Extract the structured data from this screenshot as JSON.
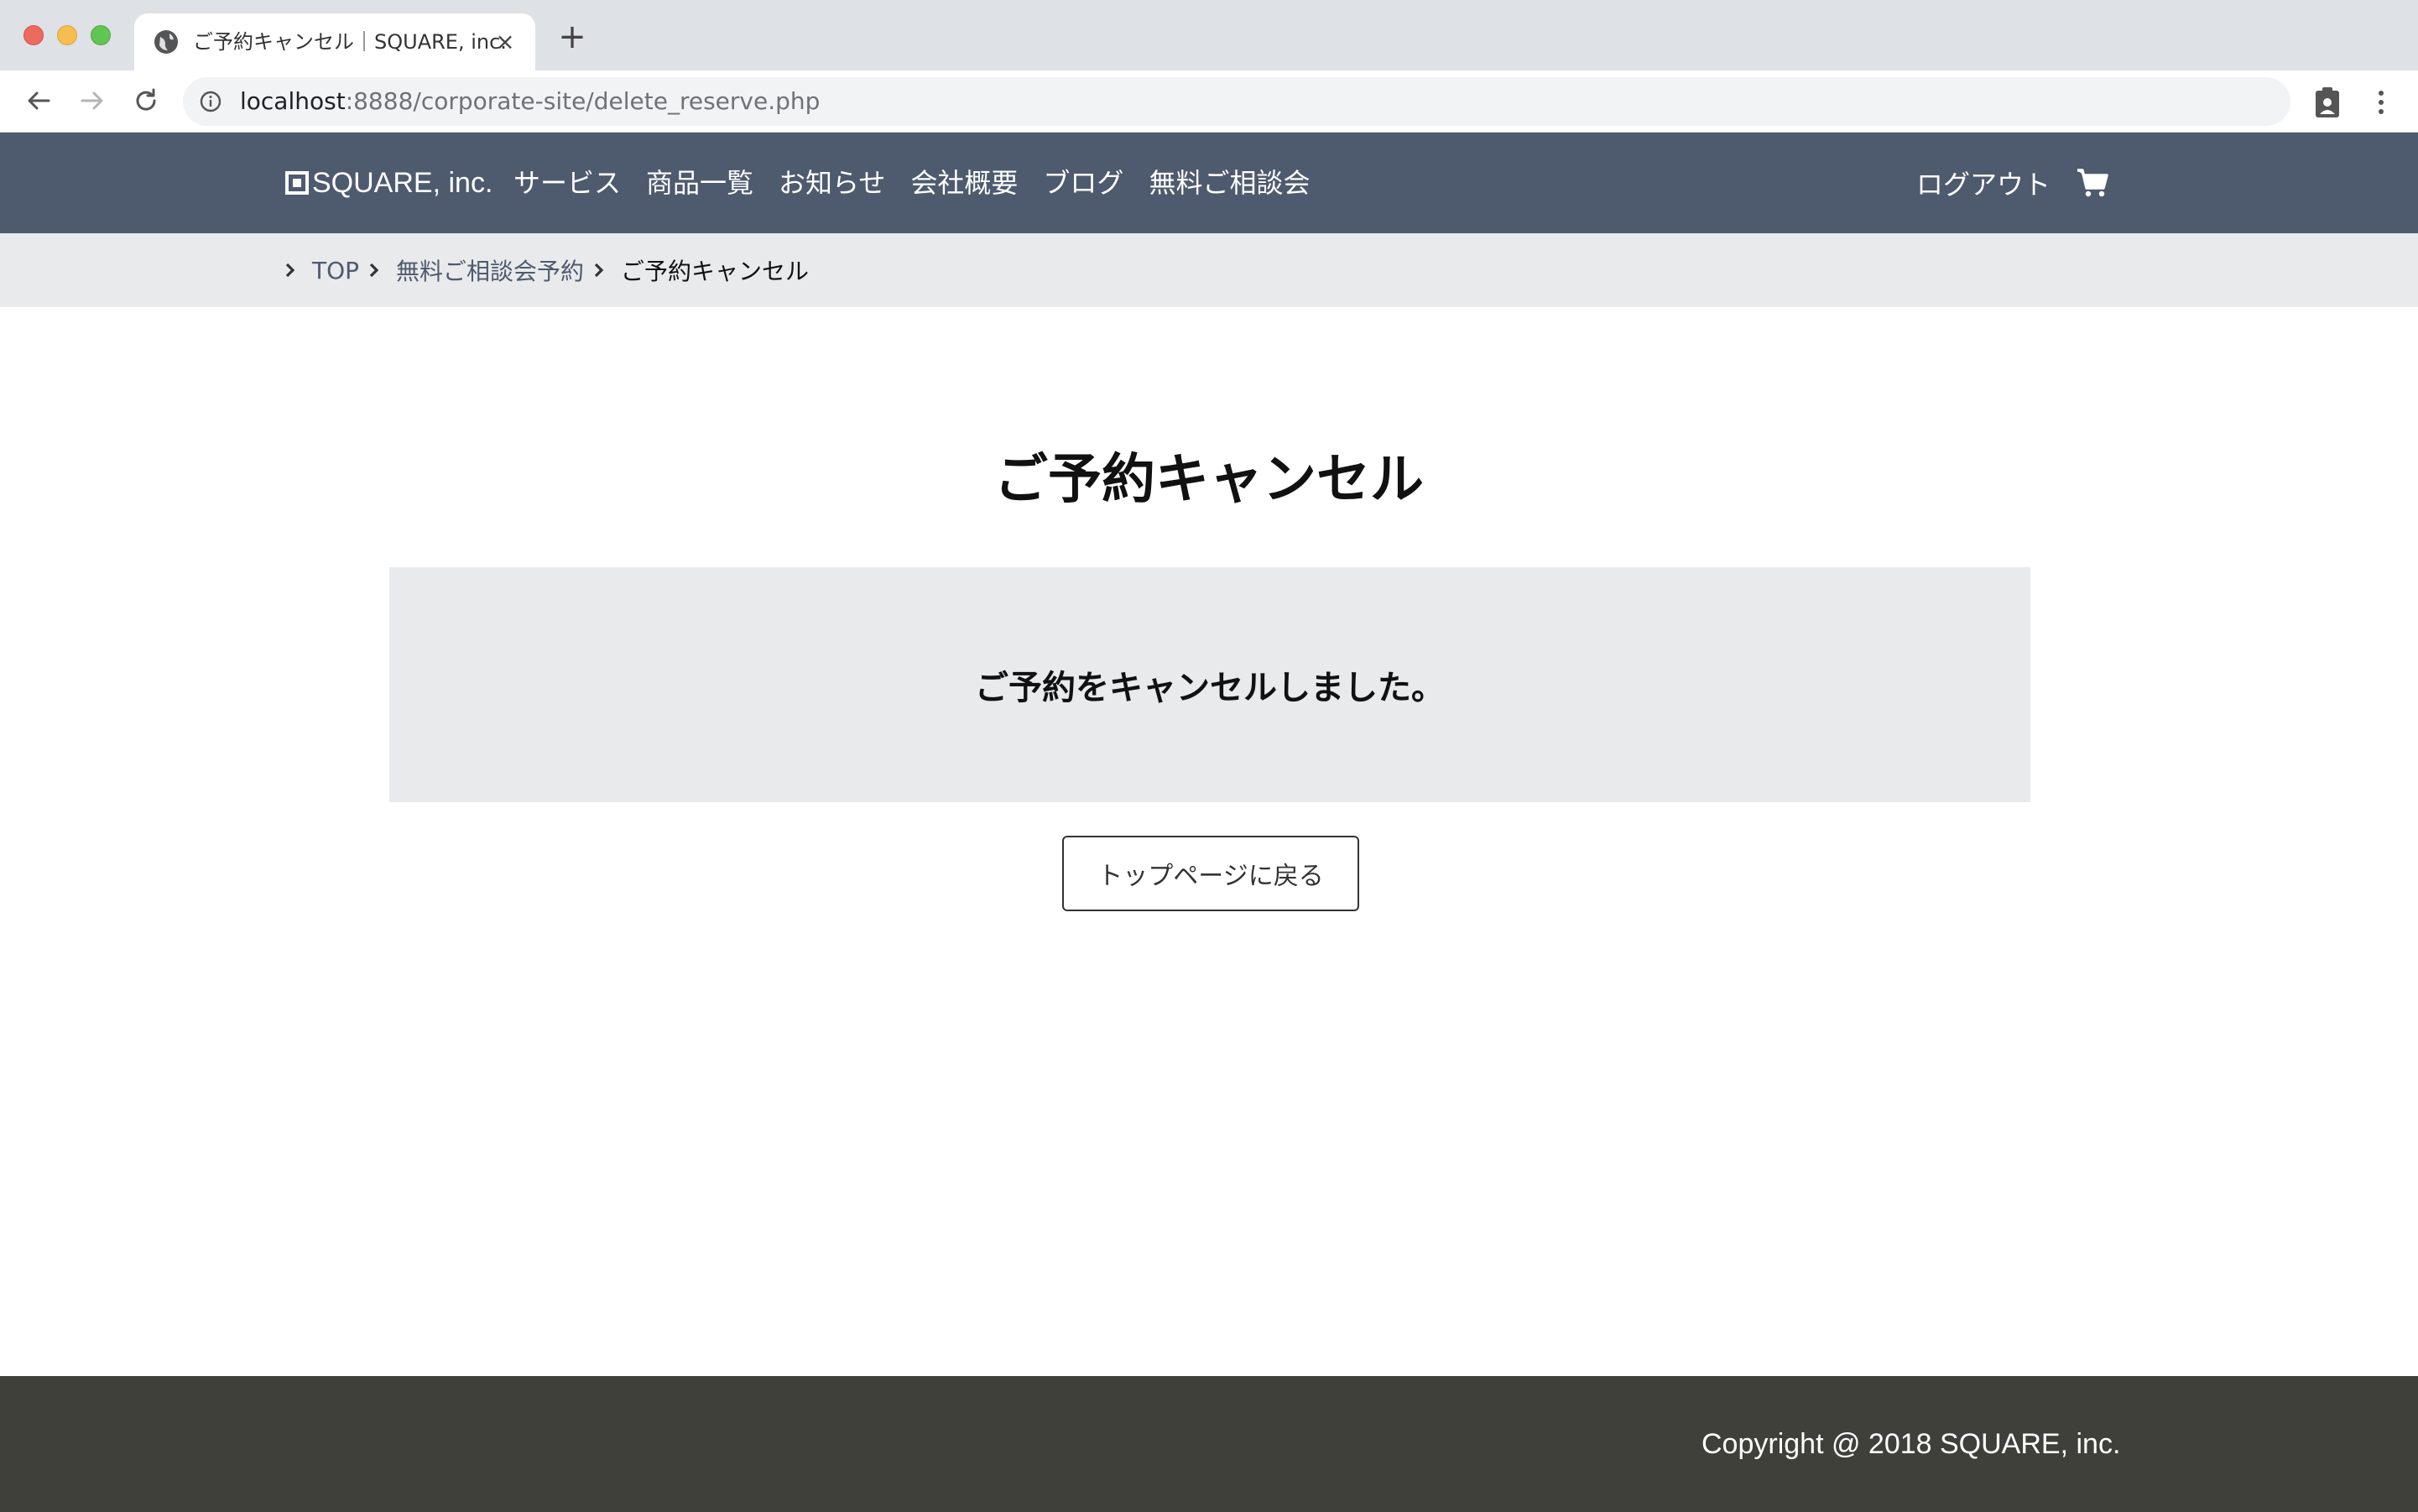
{
  "browser": {
    "tab_title": "ご予約キャンセル｜SQUARE, inc.",
    "url_host": "localhost",
    "url_path": ":8888/corporate-site/delete_reserve.php"
  },
  "header": {
    "logo_text": "SQUARE, inc.",
    "nav": [
      {
        "label": "サービス"
      },
      {
        "label": "商品一覧"
      },
      {
        "label": "お知らせ"
      },
      {
        "label": "会社概要"
      },
      {
        "label": "ブログ"
      },
      {
        "label": "無料ご相談会"
      }
    ],
    "logout_label": "ログアウト"
  },
  "breadcrumb": {
    "items": [
      {
        "label": "TOP"
      },
      {
        "label": "無料ご相談会予約"
      }
    ],
    "current": "ご予約キャンセル"
  },
  "main": {
    "title": "ご予約キャンセル",
    "message": "ご予約をキャンセルしました。",
    "back_button_label": "トップページに戻る"
  },
  "footer": {
    "copyright": "Copyright @ 2018 SQUARE, inc."
  },
  "colors": {
    "header_bg": "#4e5a6e",
    "breadcrumb_bg": "#e9eaec",
    "message_bg": "#e9eaec",
    "footer_bg": "#3f403a"
  }
}
